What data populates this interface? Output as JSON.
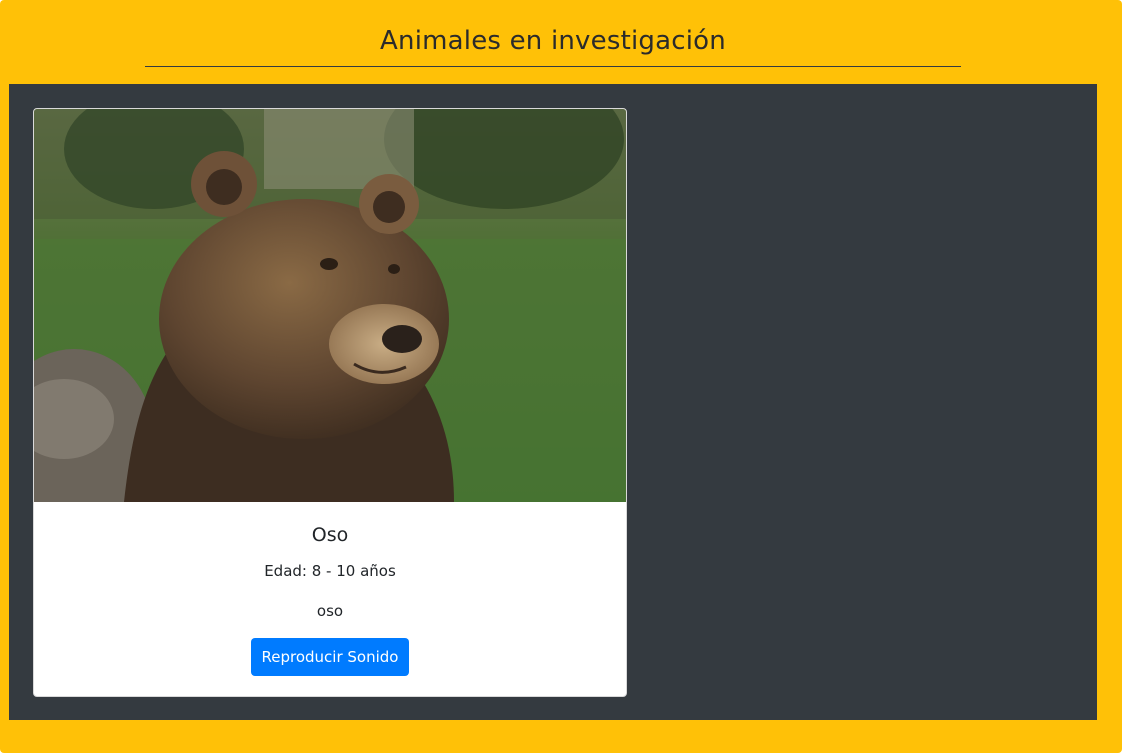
{
  "header": {
    "title": "Animales en investigación"
  },
  "card": {
    "image_subject": "brown bear photo",
    "name": "Oso",
    "age": "Edad: 8 - 10 años",
    "description": "oso",
    "button_label": "Reproducir Sonido"
  },
  "colors": {
    "frame": "#ffc107",
    "panel": "#343a40",
    "button": "#007bff",
    "card": "#ffffff"
  }
}
